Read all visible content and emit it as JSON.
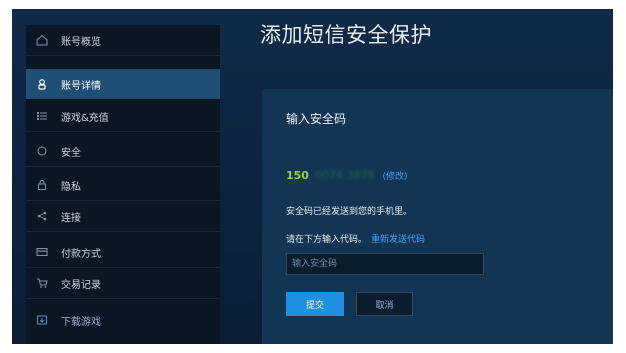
{
  "sidebar": {
    "items": [
      {
        "label": "账号概览",
        "icon": "home-icon"
      },
      {
        "label": "账号详情",
        "icon": "user-lock-icon",
        "active": true
      },
      {
        "label": "游戏&充值",
        "icon": "list-icon"
      },
      {
        "label": "安全",
        "icon": "shield-icon"
      },
      {
        "label": "隐私",
        "icon": "lock-icon"
      },
      {
        "label": "连接",
        "icon": "share-icon"
      },
      {
        "label": "付款方式",
        "icon": "credit-card-icon"
      },
      {
        "label": "交易记录",
        "icon": "cart-icon"
      },
      {
        "label": "下载游戏",
        "icon": "download-icon"
      }
    ]
  },
  "main": {
    "title": "添加短信安全保护",
    "panel": {
      "title": "输入安全码",
      "phone_prefix": "150",
      "phone_masked": "0074 3878",
      "edit_link": "(修改)",
      "sent_message": "安全码已经发送到您的手机里。",
      "enter_instruction": "请在下方输入代码。",
      "resend_link": "重新发送代码",
      "code_placeholder": "输入安全码",
      "submit_label": "提交",
      "cancel_label": "取消"
    }
  },
  "colors": {
    "accent": "#1f8fe0",
    "link": "#3aa0ff",
    "phone_green": "#8fd14f",
    "active_nav": "#1f4f76"
  }
}
